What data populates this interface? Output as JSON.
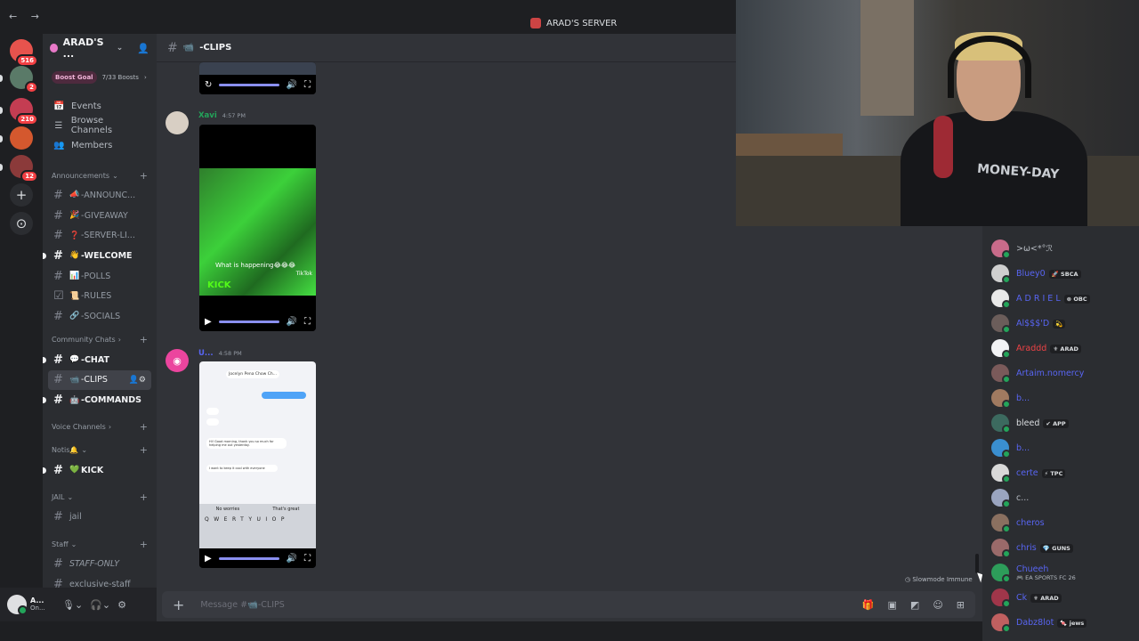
{
  "window": {
    "server_title": "ARAD'S SERVER",
    "nav_arrows": "← →"
  },
  "rail": {
    "servers": [
      {
        "badge": "516",
        "color": "#e7534d"
      },
      {
        "badge": "2",
        "color": "#5a7a68"
      },
      {
        "badge": "210",
        "color": "#c43d52"
      },
      {
        "badge": "",
        "color": "#d4582e"
      },
      {
        "badge": "12",
        "color": "#8b3a3a"
      }
    ],
    "add_icon": "+",
    "explore_icon": "⊙"
  },
  "sidebar": {
    "guild_name": "ARAD'S ...",
    "boost_goal": "Boost Goal",
    "boost_count": "7/33 Boosts",
    "nav": [
      {
        "icon": "📅",
        "label": "Events"
      },
      {
        "icon": "☰",
        "label": "Browse Channels"
      },
      {
        "icon": "👥",
        "label": "Members"
      }
    ],
    "cat_announcements": "Announcements",
    "announcement_channels": [
      {
        "emoji": "📣",
        "name": "-ANNOUNC..."
      },
      {
        "emoji": "🎉",
        "name": "-GIVEAWAY"
      },
      {
        "emoji": "❓",
        "name": "-SERVER-LI..."
      },
      {
        "emoji": "👋",
        "name": "-WELCOME"
      },
      {
        "emoji": "📊",
        "name": "-POLLS"
      },
      {
        "emoji": "📜",
        "name": "-RULES"
      },
      {
        "emoji": "🔗",
        "name": "-SOCIALS"
      }
    ],
    "cat_community": "Community Chats",
    "community_channels": [
      {
        "emoji": "💬",
        "name": "-CHAT"
      },
      {
        "emoji": "📹",
        "name": "-CLIPS"
      },
      {
        "emoji": "🤖",
        "name": "-COMMANDS"
      }
    ],
    "cat_voice": "Voice Channels",
    "cat_notis": "Notis🔔",
    "notis_channel": {
      "emoji": "💚",
      "name": "KICK"
    },
    "cat_jail": "JAIL",
    "jail_channel": "jail",
    "cat_staff": "Staff",
    "staff_channels": [
      "STAFF-ONLY",
      "exclusive-staff"
    ]
  },
  "user": {
    "name": "A...",
    "status": "On..."
  },
  "channel": {
    "name": "-CLIPS",
    "emoji": "📹"
  },
  "messages": [
    {
      "author": "Xavi",
      "time": "4:57 PM",
      "caption": "What is happening😂😂😂",
      "watermark": "TikTok",
      "brand": "KICK"
    },
    {
      "author": "U...",
      "time": "4:58 PM",
      "phone_header": "Jocelyn Pena Chow Ch...",
      "phone_lines": [
        "Hi! Good morning, thank you so much for helping me out yesterday.",
        "I want to keep it cool with everyone"
      ],
      "kb_suggest": [
        "No worries",
        "That's great"
      ],
      "kb_row1": "QWERTYUIOP"
    }
  ],
  "composer": {
    "placeholder": "Message #📹-CLIPS"
  },
  "slowmode": "Slowmode Immune",
  "members": [
    {
      "name": ">ω<*°ℛ",
      "color": "#b5bac1",
      "tag": "",
      "avatar": "#c86b8a"
    },
    {
      "name": "Bluey0",
      "color": "#5865f2",
      "tag": "🚀 SBCA",
      "avatar": "#cfcfcf"
    },
    {
      "name": "A D R I E L",
      "color": "#5865f2",
      "tag": "⊗ OBC",
      "avatar": "#e9e9e9"
    },
    {
      "name": "Al$$$'D",
      "color": "#5865f2",
      "tag": "💫",
      "avatar": "#6b5d5a"
    },
    {
      "name": "Araddd",
      "color": "#ed4245",
      "tag": "⚜ ARAD",
      "avatar": "#f2f3f5"
    },
    {
      "name": "Artaim.nomercy",
      "color": "#5865f2",
      "tag": "",
      "avatar": "#7a5a5a"
    },
    {
      "name": "b...",
      "color": "#5865f2",
      "tag": "",
      "avatar": "#a07a60"
    },
    {
      "name": "bleed",
      "color": "#dbdee1",
      "tag": "✔ APP",
      "avatar": "#3c6a5f"
    },
    {
      "name": "b...",
      "color": "#5865f2",
      "tag": "",
      "avatar": "#3a8fd0"
    },
    {
      "name": "certe",
      "color": "#5865f2",
      "tag": "⚡ TPC",
      "avatar": "#d9d9d9"
    },
    {
      "name": "c...",
      "color": "#b5bac1",
      "tag": "",
      "avatar": "#9aa5c0"
    },
    {
      "name": "cheros",
      "color": "#5865f2",
      "tag": "",
      "avatar": "#8a7060"
    },
    {
      "name": "chris",
      "color": "#5865f2",
      "tag": "💎 GUNS",
      "avatar": "#9a6a6a"
    },
    {
      "name": "Chueeh",
      "color": "#5865f2",
      "tag": "",
      "sub": "🎮 EA SPORTS FC 26",
      "avatar": "#2d9d5a"
    },
    {
      "name": "Ck",
      "color": "#5865f2",
      "tag": "⚜ ARAD",
      "avatar": "#a0364a"
    },
    {
      "name": "Dabz8lot",
      "color": "#5865f2",
      "tag": "🍬 jews",
      "avatar": "#c06060"
    }
  ],
  "webcam": {
    "shirt_text": "MONEY-DAY"
  }
}
